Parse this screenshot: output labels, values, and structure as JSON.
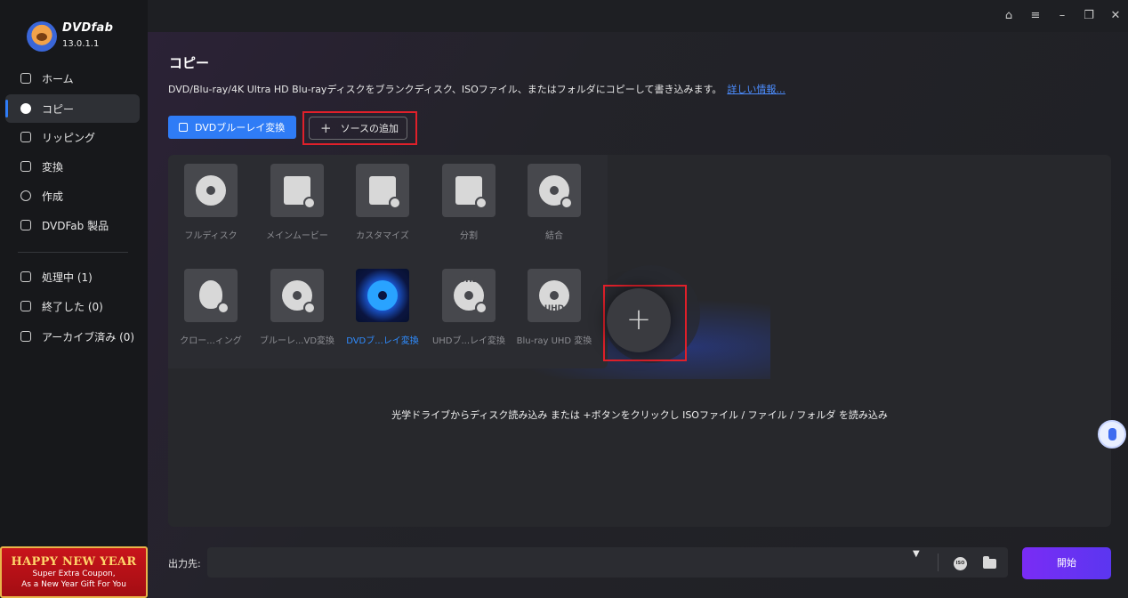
{
  "app": {
    "brand": "DVDfab",
    "version": "13.0.1.1"
  },
  "sidebar": {
    "items": [
      {
        "label": "ホーム",
        "icon": "home-icon"
      },
      {
        "label": "コピー",
        "icon": "copy-disc-icon",
        "active": true
      },
      {
        "label": "リッピング",
        "icon": "ripper-icon"
      },
      {
        "label": "変換",
        "icon": "converter-icon"
      },
      {
        "label": "作成",
        "icon": "creator-icon"
      },
      {
        "label": "DVDFab 製品",
        "icon": "products-icon"
      }
    ],
    "queue": [
      {
        "label": "処理中 (1)",
        "icon": "processing-icon"
      },
      {
        "label": "終了した (0)",
        "icon": "finished-icon"
      },
      {
        "label": "アーカイブ済み (0)",
        "icon": "archive-icon"
      }
    ],
    "promo": {
      "title": "HAPPY NEW YEAR",
      "line1": "Super Extra Coupon,",
      "line2": "As a New Year Gift For You"
    }
  },
  "main": {
    "title": "コピー",
    "description": "DVD/Blu-ray/4K Ultra HD Blu-rayディスクをブランクディスク、ISOファイル、またはフォルダにコピーして書き込みます。",
    "more_link": "詳しい情報...",
    "dvd_button": "DVDブルーレイ変換",
    "add_source": "ソースの追加",
    "modes": [
      {
        "label": "フルディスク",
        "icon": "full-disc-icon"
      },
      {
        "label": "メインムービー",
        "icon": "main-movie-icon"
      },
      {
        "label": "カスタマイズ",
        "icon": "customize-icon"
      },
      {
        "label": "分割",
        "icon": "split-icon"
      },
      {
        "label": "結合",
        "icon": "merge-icon"
      },
      {
        "label": "クローン/ライティング",
        "display": "クロー...ィング",
        "icon": "clone-burn-icon"
      },
      {
        "label": "ブルーレイ...VD変換",
        "display": "ブルーレ...VD変換",
        "icon": "bluray-to-dvd-icon"
      },
      {
        "label": "DVDブルーレイ変換",
        "display": "DVDブ...レイ変換",
        "icon": "dvd-to-bluray-icon",
        "selected": true
      },
      {
        "label": "UHDブ...レイ変換",
        "display": "UHDブ...レイ変換",
        "icon": "uhd-to-bluray-icon",
        "tile_text": "UHD"
      },
      {
        "label": "Blu-ray UHD 変換",
        "display": "Blu-ray UHD 変換",
        "icon": "bluray-to-uhd-icon",
        "tile_text": "UHD"
      }
    ],
    "hint": "光学ドライブからディスク読み込み または +ボタンをクリックし ISOファイル / ファイル / フォルダ を読み込み",
    "output_label": "出力先:",
    "iso_text": "ISO",
    "start_button": "開始"
  },
  "colors": {
    "accent": "#2f7cf6",
    "start": "#6a31f3",
    "highlight": "#e0202a"
  }
}
